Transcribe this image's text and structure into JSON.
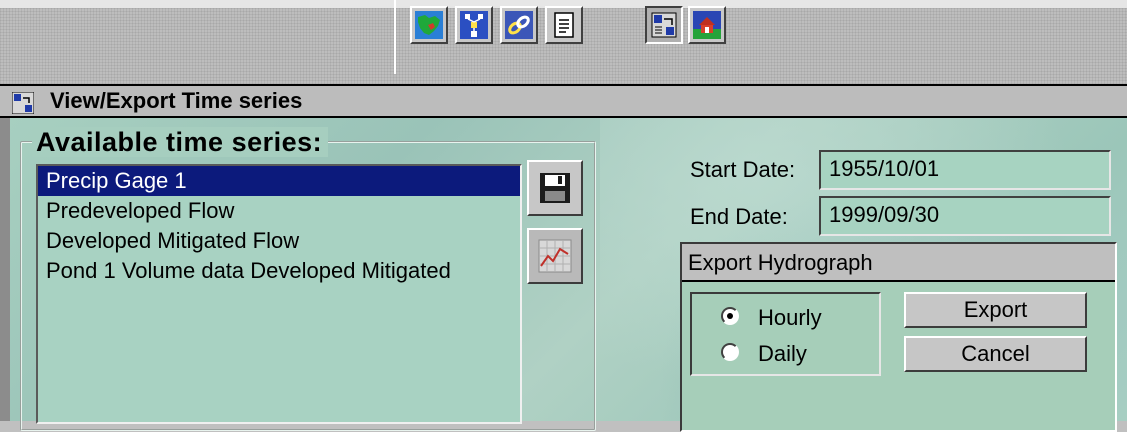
{
  "toolbar": {
    "buttons": [
      {
        "icon": "map-icon"
      },
      {
        "icon": "network-icon"
      },
      {
        "icon": "link-icon"
      },
      {
        "icon": "report-icon"
      },
      {
        "icon": "export-icon",
        "pressed": true
      },
      {
        "icon": "house-icon"
      }
    ]
  },
  "window": {
    "title": "View/Export Time series"
  },
  "timeseries": {
    "group_title": "Available time series:",
    "items": [
      "Precip Gage 1",
      "Predeveloped Flow",
      "Developed Mitigated Flow",
      "Pond  1  Volume data Developed Mitigated"
    ],
    "selected_index": 0
  },
  "dates": {
    "start_label": "Start Date:",
    "start_value": "1955/10/01",
    "end_label": "End Date:",
    "end_value": "1999/09/30"
  },
  "export": {
    "title": "Export Hydrograph",
    "hourly_label": "Hourly",
    "daily_label": "Daily",
    "selected": "Hourly",
    "export_label": "Export",
    "cancel_label": "Cancel"
  }
}
